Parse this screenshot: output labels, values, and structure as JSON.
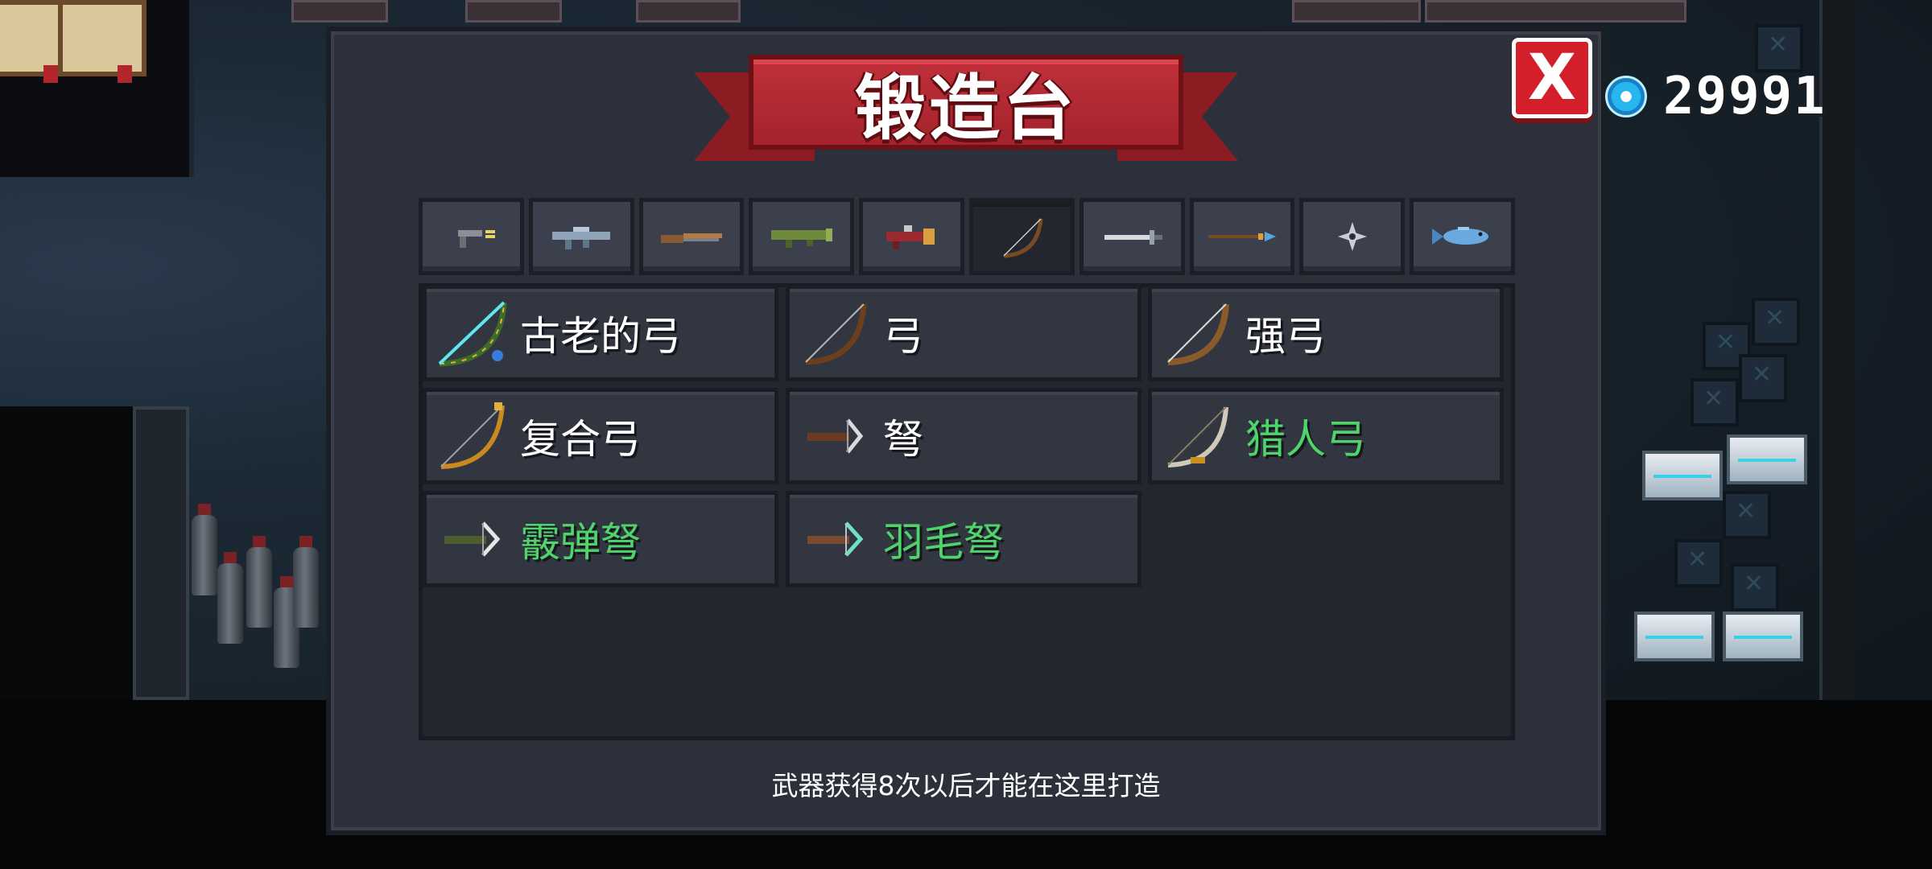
{
  "header": {
    "title": "锻造台",
    "close_label": "X"
  },
  "currency": {
    "icon": "gem-icon",
    "value": "29991",
    "color": "#27b7ee"
  },
  "tabs": [
    {
      "icon": "pistol-icon",
      "active": false
    },
    {
      "icon": "rifle-icon",
      "active": false
    },
    {
      "icon": "shotgun-icon",
      "active": false
    },
    {
      "icon": "launcher-icon",
      "active": false
    },
    {
      "icon": "laser-gun-icon",
      "active": false
    },
    {
      "icon": "bow-icon",
      "active": true
    },
    {
      "icon": "sword-icon",
      "active": false
    },
    {
      "icon": "spear-icon",
      "active": false
    },
    {
      "icon": "shuriken-icon",
      "active": false
    },
    {
      "icon": "fish-icon",
      "active": false
    }
  ],
  "items": [
    {
      "label": "古老的弓",
      "icon": "ancient-bow-icon",
      "highlight": false
    },
    {
      "label": "弓",
      "icon": "bow-icon",
      "highlight": false
    },
    {
      "label": "强弓",
      "icon": "strong-bow-icon",
      "highlight": false
    },
    {
      "label": "复合弓",
      "icon": "compound-bow-icon",
      "highlight": false
    },
    {
      "label": "弩",
      "icon": "crossbow-icon",
      "highlight": false
    },
    {
      "label": "猎人弓",
      "icon": "hunter-bow-icon",
      "highlight": true
    },
    {
      "label": "霰弹弩",
      "icon": "scatter-crossbow-icon",
      "highlight": true
    },
    {
      "label": "羽毛弩",
      "icon": "feather-crossbow-icon",
      "highlight": true
    }
  ],
  "footer": {
    "hint": "武器获得8次以后才能在这里打造"
  },
  "colors": {
    "panel": "#2c303a",
    "banner": "#a4232c",
    "highlight_text": "#4fd36b",
    "close_button": "#d31f2a"
  }
}
